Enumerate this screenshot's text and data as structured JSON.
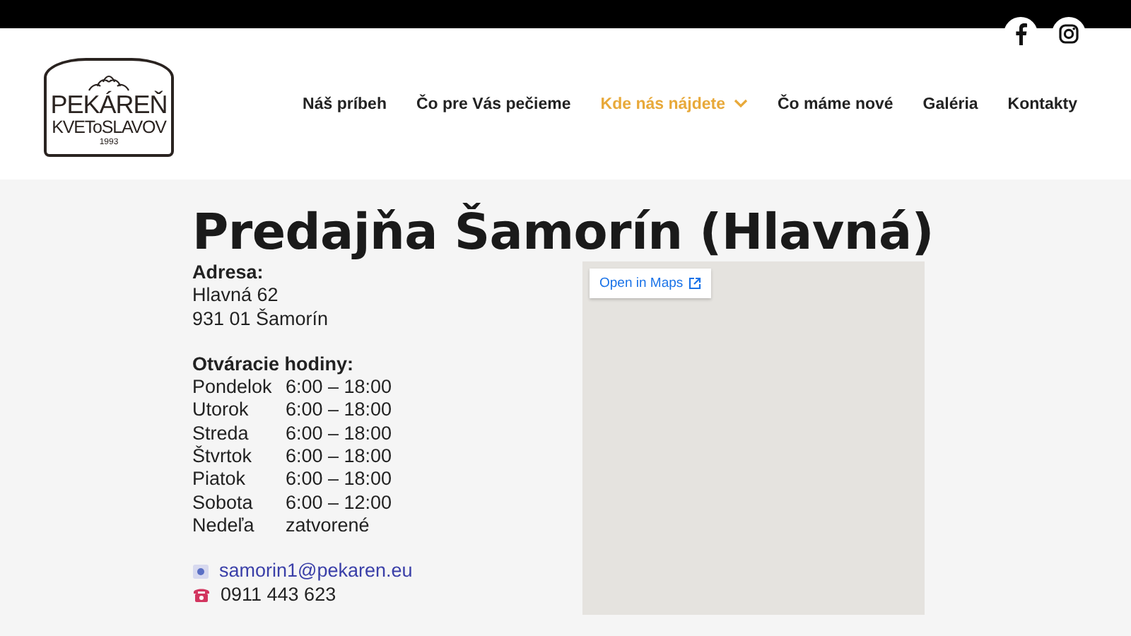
{
  "logo": {
    "line_1": "PEKÁREŇ",
    "line_2": "KVEToSLAVOV",
    "year": "1993"
  },
  "nav": [
    {
      "label": "Náš príbeh",
      "selected": false,
      "dropdown": false
    },
    {
      "label": "Čo pre Vás pečieme",
      "selected": false,
      "dropdown": false
    },
    {
      "label": "Kde nás nájdete",
      "selected": true,
      "dropdown": true
    },
    {
      "label": "Čo máme nové",
      "selected": false,
      "dropdown": false
    },
    {
      "label": "Galéria",
      "selected": false,
      "dropdown": false
    },
    {
      "label": "Kontakty",
      "selected": false,
      "dropdown": false
    }
  ],
  "social": [
    {
      "kind": "facebook"
    },
    {
      "kind": "instagram"
    }
  ],
  "title": "Predajňa Šamorín (Hlavná)",
  "address": {
    "heading": "Adresa:",
    "lines": [
      "Hlavná 62",
      "931 01 Šamorín"
    ]
  },
  "hours": {
    "heading": "Otváracie hodiny:",
    "rows": [
      {
        "day": "Pondelok",
        "time": "6:00 – 18:00"
      },
      {
        "day": "Utorok",
        "time": "6:00 – 18:00"
      },
      {
        "day": "Streda",
        "time": "6:00 – 18:00"
      },
      {
        "day": "Štvrtok",
        "time": "6:00 – 18:00"
      },
      {
        "day": "Piatok",
        "time": "6:00 – 18:00"
      },
      {
        "day": "Sobota",
        "time": "6:00 – 12:00"
      },
      {
        "day": "Nedeľa",
        "time": "zatvorené"
      }
    ]
  },
  "contacts": [
    {
      "kind": "email",
      "text": "samorin1@pekaren.eu"
    },
    {
      "kind": "phone",
      "text": "0911 443 623"
    }
  ],
  "map": {
    "button": "Open in Maps"
  }
}
